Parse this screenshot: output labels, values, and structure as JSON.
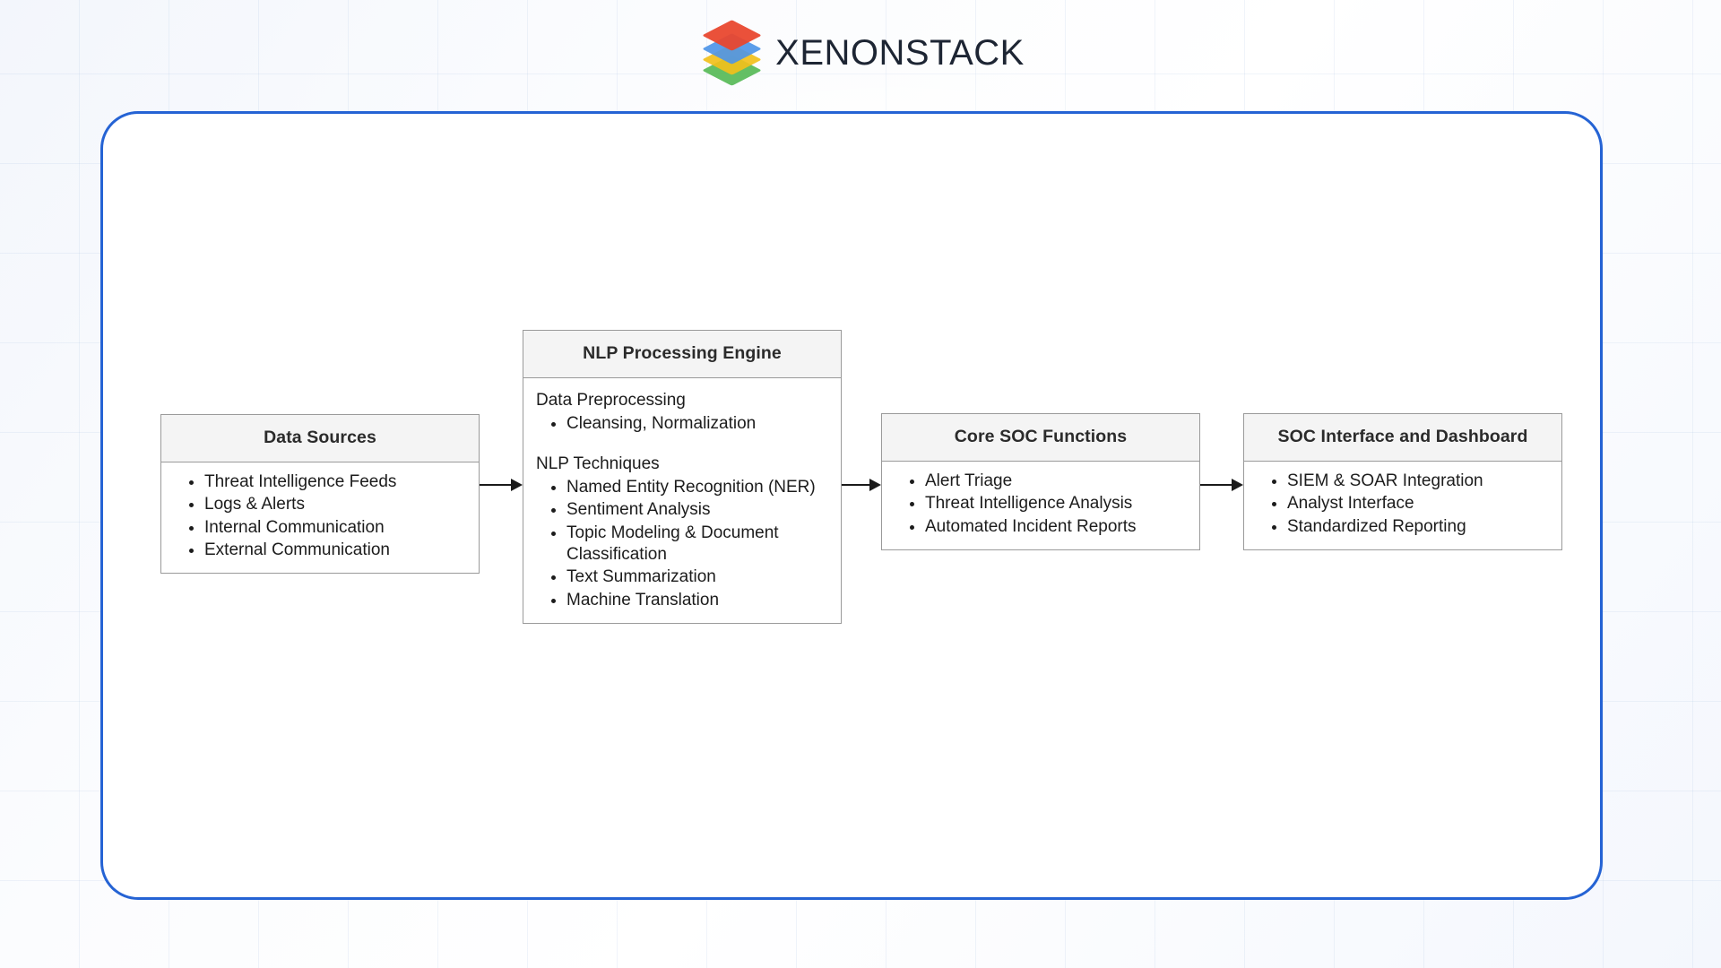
{
  "brand": {
    "name": "XENONSTACK",
    "logo_icon": "stacked-layers-icon",
    "logo_layer_colors": [
      "#e8472f",
      "#4e95e8",
      "#f2bf1b",
      "#55b955"
    ],
    "text_color": "#1d2533"
  },
  "panel": {
    "border_color": "#2563d4",
    "background_color": "#ffffff"
  },
  "diagram": {
    "type": "flowchart",
    "node_header_fill": "#f4f4f4",
    "node_border_color": "#9a9a9a",
    "arrow_color": "#1a1a1a",
    "nodes": [
      {
        "id": "data-sources",
        "title": "Data Sources",
        "items": [
          "Threat Intelligence Feeds",
          "Logs & Alerts",
          "Internal Communication",
          "External Communication"
        ]
      },
      {
        "id": "nlp-engine",
        "title": "NLP Processing Engine",
        "sections": [
          {
            "heading": "Data Preprocessing",
            "items": [
              "Cleansing, Normalization"
            ]
          },
          {
            "heading": "NLP Techniques",
            "items": [
              "Named Entity Recognition (NER)",
              "Sentiment Analysis",
              "Topic Modeling & Document Classification",
              "Text Summarization",
              "Machine Translation"
            ]
          }
        ]
      },
      {
        "id": "core-soc",
        "title": "Core SOC Functions",
        "items": [
          "Alert Triage",
          "Threat Intelligence Analysis",
          "Automated Incident Reports"
        ]
      },
      {
        "id": "soc-ui",
        "title": "SOC Interface and Dashboard",
        "items": [
          "SIEM & SOAR Integration",
          "Analyst Interface",
          "Standardized Reporting"
        ]
      }
    ],
    "connections": [
      {
        "from": "data-sources",
        "to": "nlp-engine"
      },
      {
        "from": "nlp-engine",
        "to": "core-soc"
      },
      {
        "from": "core-soc",
        "to": "soc-ui"
      }
    ]
  }
}
